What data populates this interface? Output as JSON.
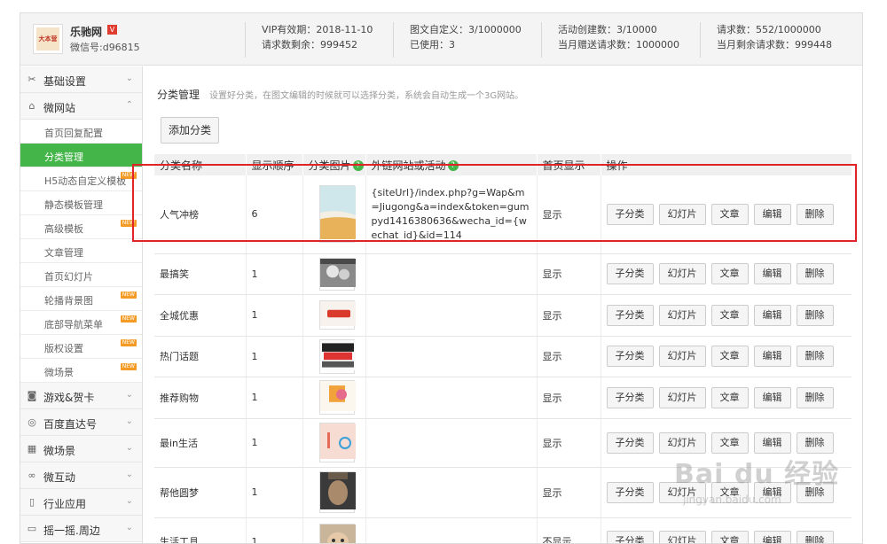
{
  "header": {
    "brand_name": "乐驰网",
    "brand_badge": "V",
    "account_id": "微信号:d96815",
    "logo_text": "大本营",
    "stats": [
      [
        "VIP有效期：2018-11-10",
        "请求数剩余：999452"
      ],
      [
        "图文自定义：3/1000000",
        "已使用：3"
      ],
      [
        "活动创建数：3/10000",
        "当月赠送请求数：1000000"
      ],
      [
        "请求数：552/1000000",
        "当月剩余请求数：999448"
      ]
    ]
  },
  "sidebar": {
    "groups_top": [
      {
        "label": "基础设置",
        "icon": "wrench-icon",
        "glyph": "✂",
        "chev": "⌄"
      },
      {
        "label": "微网站",
        "icon": "home-icon",
        "glyph": "⌂",
        "chev": "⌃"
      }
    ],
    "items": [
      {
        "label": "首页回复配置",
        "new": false
      },
      {
        "label": "分类管理",
        "new": false,
        "active": true
      },
      {
        "label": "H5动态自定义模板",
        "new": true
      },
      {
        "label": "静态模板管理",
        "new": false
      },
      {
        "label": "高级模板",
        "new": true
      },
      {
        "label": "文章管理",
        "new": false
      },
      {
        "label": "首页幻灯片",
        "new": false
      },
      {
        "label": "轮播背景图",
        "new": true
      },
      {
        "label": "底部导航菜单",
        "new": true
      },
      {
        "label": "版权设置",
        "new": true
      },
      {
        "label": "微场景",
        "new": true
      }
    ],
    "new_badge": "NEW",
    "groups_bottom": [
      {
        "label": "游戏&贺卡",
        "icon": "gamepad-icon",
        "glyph": "◙",
        "chev": "⌄"
      },
      {
        "label": "百度直达号",
        "icon": "target-icon",
        "glyph": "◎",
        "chev": "⌄"
      },
      {
        "label": "微场景",
        "icon": "grid-icon",
        "glyph": "▦",
        "chev": "⌄"
      },
      {
        "label": "微互动",
        "icon": "link-icon",
        "glyph": "∞",
        "chev": "⌄"
      },
      {
        "label": "行业应用",
        "icon": "phone-icon",
        "glyph": "▯",
        "chev": "⌄"
      },
      {
        "label": "摇一摇.周边",
        "icon": "shake-icon",
        "glyph": "▭",
        "chev": "⌄"
      }
    ]
  },
  "main": {
    "title": "分类管理",
    "description": "设置好分类，在图文编辑的时候就可以选择分类，系统会自动生成一个3G网站。",
    "add_button": "添加分类",
    "columns": [
      "分类名称",
      "显示顺序",
      "分类图片",
      "外链网站或活动",
      "首页显示",
      "操作"
    ],
    "help_glyph": "?",
    "ops": [
      "子分类",
      "幻灯片",
      "文章",
      "编辑",
      "删除"
    ],
    "rows": [
      {
        "name": "人气冲榜",
        "order": "6",
        "link": "{siteUrl}/index.php?g=Wap&m=Jiugong&a=index&token=gumpyd1416380636&wecha_id={wechat_id}&id=114",
        "show": "显示",
        "img": "beach"
      },
      {
        "name": "最搞笑",
        "order": "1",
        "link": "",
        "show": "显示",
        "img": "photo"
      },
      {
        "name": "全城优惠",
        "order": "1",
        "link": "",
        "show": "显示",
        "img": "promo"
      },
      {
        "name": "热门话题",
        "order": "1",
        "link": "",
        "show": "显示",
        "img": "news"
      },
      {
        "name": "推荐购物",
        "order": "1",
        "link": "",
        "show": "显示",
        "img": "shop"
      },
      {
        "name": "最in生活",
        "order": "1",
        "link": "",
        "show": "显示",
        "img": "life"
      },
      {
        "name": "帮他圆梦",
        "order": "1",
        "link": "",
        "show": "显示",
        "img": "portrait"
      },
      {
        "name": "生活工具",
        "order": "1",
        "link": "",
        "show": "不显示",
        "img": "tools"
      }
    ]
  },
  "watermark": {
    "big": "Bai du 经验",
    "small": "jingyan.baidu.com"
  },
  "colors": {
    "accent": "#44b549",
    "highlight": "#e0242a",
    "new_badge": "#f39b25"
  }
}
